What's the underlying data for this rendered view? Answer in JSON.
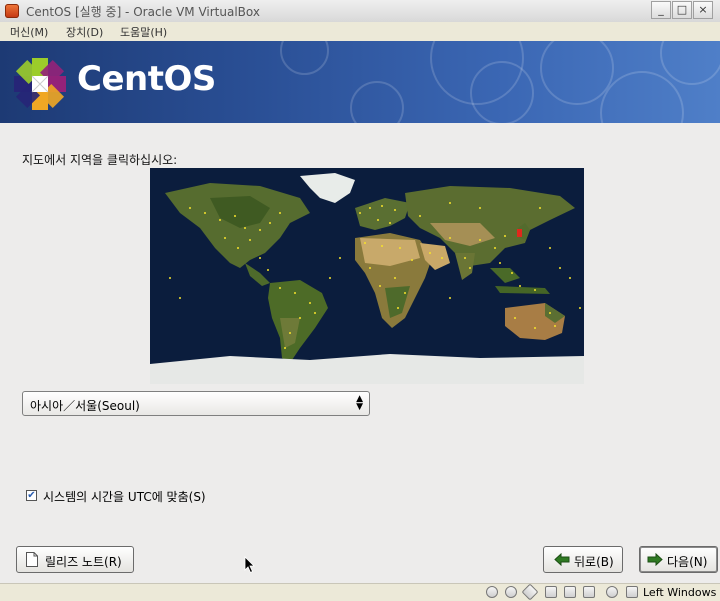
{
  "window": {
    "title": "CentOS [실행 중] - Oracle VM VirtualBox",
    "buttons": [
      "_",
      "□",
      "×"
    ]
  },
  "menubar": {
    "items": [
      "머신(M)",
      "장치(D)",
      "도움말(H)"
    ]
  },
  "banner": {
    "logo_text": "CentOS"
  },
  "installer": {
    "map_prompt": "지도에서 지역을 클릭하십시오:",
    "timezone_selected": "아시아／서울(Seoul)",
    "utc_checkbox_label": "시스템의 시간을 UTC에 맞춤(S)",
    "utc_checked": true,
    "release_notes_button": "릴리즈 노트(R)",
    "back_button": "뒤로(B)",
    "next_button": "다음(N)"
  },
  "statusbar": {
    "host_key": "Left Windows"
  },
  "colors": {
    "banner_dark": "#1d3a74",
    "banner_light": "#4f7fc8",
    "ocean": "#0b1d3d",
    "city_dot": "#f6e22c",
    "selected_city": "#e0281c"
  }
}
